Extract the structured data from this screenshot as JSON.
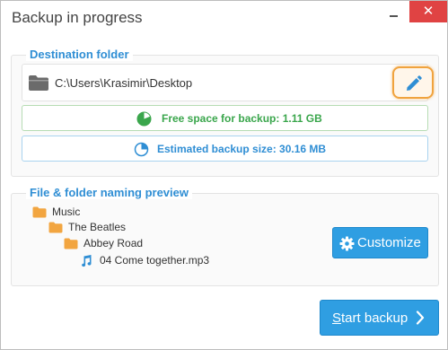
{
  "window": {
    "title": "Backup in progress",
    "close_glyph": "✕",
    "accent_color": "#2f9ee2",
    "close_color": "#e04343"
  },
  "destination": {
    "legend": "Destination folder",
    "folder_icon": "folder-icon",
    "path": "C:\\Users\\Krasimir\\Desktop",
    "edit_icon": "pencil-icon",
    "free_space_icon": "pie-chart-icon",
    "free_space": "Free space for backup: 1.11 GB",
    "estimated_icon": "pie-chart-outline-icon",
    "estimated": "Estimated backup size: 30.16 MB"
  },
  "naming_preview": {
    "legend": "File & folder naming preview",
    "tree": [
      {
        "label": "Music",
        "icon": "folder-icon"
      },
      {
        "label": "The Beatles",
        "icon": "folder-icon"
      },
      {
        "label": "Abbey Road",
        "icon": "folder-icon"
      },
      {
        "label": "04 Come together.mp3",
        "icon": "music-note-icon"
      }
    ],
    "customize_label": "Customize",
    "customize_icon": "gear-icon"
  },
  "footer": {
    "start_first_letter": "S",
    "start_rest": "tart backup",
    "start_icon": "chevron-right-icon"
  }
}
